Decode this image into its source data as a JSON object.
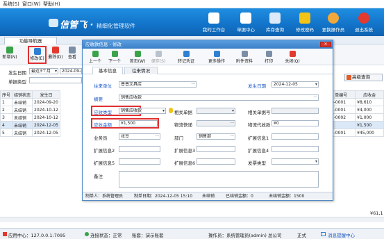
{
  "menubar": {
    "items": [
      "系统(S)",
      "窗口(W)",
      "帮助(H)"
    ]
  },
  "header": {
    "logo_name": "信管飞",
    "logo_sub": "精细化管理软件",
    "buttons": [
      {
        "label": "我的工作台",
        "icon": "workbench-icon",
        "color": "#ffffff"
      },
      {
        "label": "单据中心",
        "icon": "document-center-icon",
        "color": "#ffffff"
      },
      {
        "label": "库存查询",
        "icon": "inventory-icon",
        "color": "#2b6fbf"
      },
      {
        "label": "修改密码",
        "icon": "lock-icon",
        "color": "#f3c316"
      },
      {
        "label": "更换操作员",
        "icon": "user-icon",
        "color": "#f2a83a"
      },
      {
        "label": "退出系统",
        "icon": "exit-icon",
        "color": "#e23a2e"
      }
    ]
  },
  "nav": {
    "tab": "功能导航器",
    "right_tab": "界面设计"
  },
  "subtool": {
    "buttons": [
      "新增(N)",
      "修改(E)",
      "删除(D)",
      "查看"
    ]
  },
  "filter": {
    "date_label": "发生日期",
    "date_range": "最近3个月",
    "date_value": "2024-09-0",
    "type_label": "单据类型",
    "right_button": "高级查询"
  },
  "grid": {
    "headers": [
      "序号",
      "结销状态",
      "发生日"
    ],
    "rows": [
      [
        "1",
        "未结销",
        "2024-09-20"
      ],
      [
        "2",
        "未结销",
        "2024-10-12"
      ],
      [
        "3",
        "未结销",
        "2024-10-12"
      ],
      [
        "4",
        "未结销",
        "2024-12-05"
      ],
      [
        "5",
        "未结销",
        "2024-12-05"
      ]
    ]
  },
  "rightgrid": {
    "headers": [
      "单编号",
      "应收金"
    ],
    "rows": [
      [
        "20-0001",
        "¥8,610"
      ],
      [
        "12-0001",
        "¥4,000"
      ],
      [
        "12-0002",
        "¥1,000"
      ],
      [
        "",
        "¥1,500"
      ],
      [
        "05-0001",
        "¥45,000"
      ]
    ],
    "total": "¥61,1"
  },
  "dialog": {
    "title": "应收款信息 - 修改",
    "close": "✕",
    "tool": [
      "上一个",
      "下一个",
      "首页(W)",
      "保存(S)",
      "转记凭证",
      "更多操作",
      "附件资料",
      "打印",
      "关闭(Q)"
    ],
    "tabs": [
      "基本信息",
      "往来情况"
    ],
    "fields": {
      "unit_label": "往来单位",
      "unit_value": "普普文具店",
      "date_label": "发生日期",
      "date_value": "2024-12-05",
      "summary_label": "摘要",
      "summary_value": "销售应收款",
      "type_label": "应收类型",
      "type_value": "销售应收款",
      "rel_doc_label": "相关单据",
      "rel_docno_label": "相关单据号",
      "amount_label": "应收金额",
      "amount_value": "¥1,500",
      "logistics_label": "物流快递",
      "logistics_cod_label": "物流代收款",
      "logistics_cod_value": "¥0",
      "sales_label": "业务员",
      "sales_value": "张豆",
      "dept_label": "部门",
      "dept_value": "销售部",
      "ext1": "扩展信息1",
      "ext2": "扩展信息2",
      "ext3": "扩展信息3",
      "ext4": "扩展信息4",
      "ext5": "扩展信息5",
      "ext6": "扩展信息6",
      "invoice_label": "发票类型",
      "note_label": "备注"
    },
    "footer": [
      "制单人：系统管理员",
      "制单日期：2024-12-05 15:10",
      "未结销",
      "已结销金额：0",
      "未结销金额：1500"
    ]
  },
  "status": {
    "items": [
      "应用中心：127.0.0.1:7095",
      "连接状态：正常",
      "账套：演示账套",
      "操作员：系统管理员(admin) 总公司",
      "正式",
      "消息提醒中心"
    ]
  }
}
